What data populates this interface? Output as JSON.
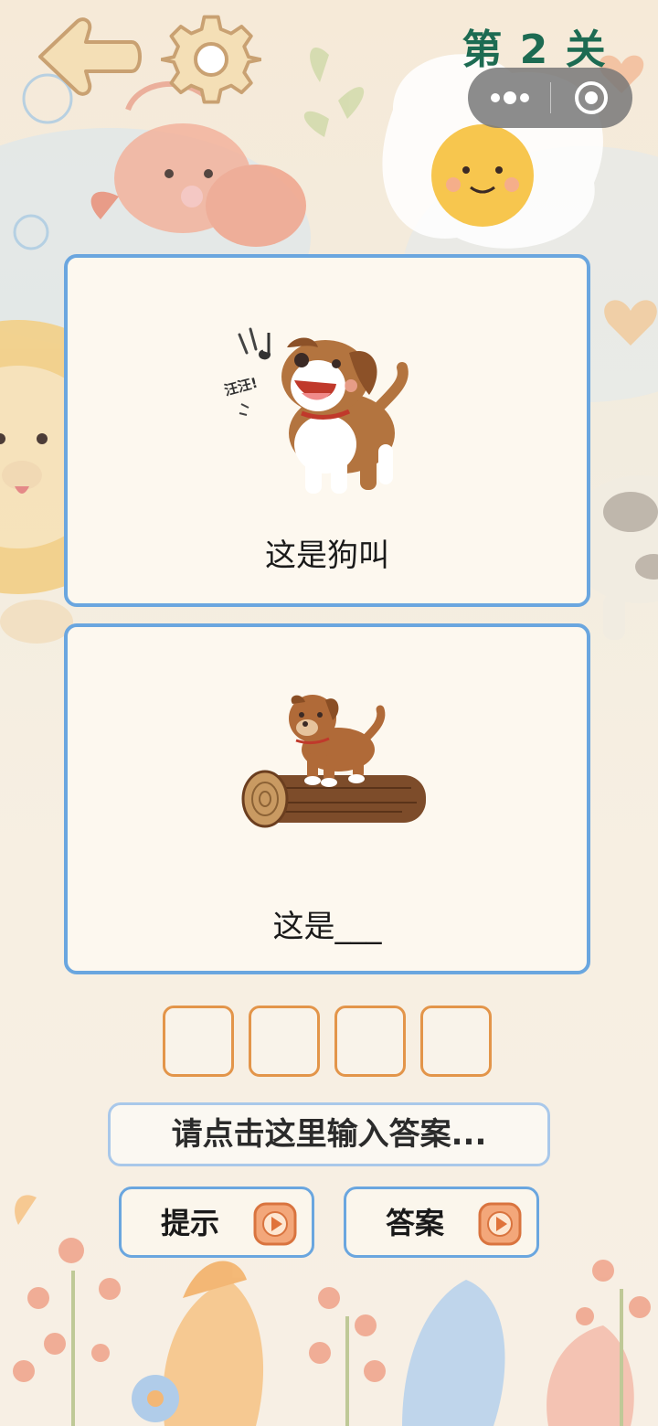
{
  "header": {
    "level_title": "第 2 关",
    "back_icon": "arrow-left-icon",
    "settings_icon": "gear-icon"
  },
  "capsule": {
    "more_icon": "more-dots-icon",
    "close_icon": "target-circle-icon"
  },
  "cards": [
    {
      "caption": "这是狗叫",
      "bubble_text": "汪汪!",
      "image": "barking-dog"
    },
    {
      "caption": "这是___",
      "image": "dog-on-log"
    }
  ],
  "answer": {
    "slot_count": 4,
    "input_placeholder": "请点击这里输入答案..."
  },
  "buttons": {
    "hint_label": "提示",
    "answer_label": "答案",
    "play_icon": "play-icon"
  },
  "colors": {
    "level_title": "#1d6b52",
    "card_border": "#6aa6df",
    "slot_border": "#e3954a",
    "input_border": "#a9c8ea"
  }
}
